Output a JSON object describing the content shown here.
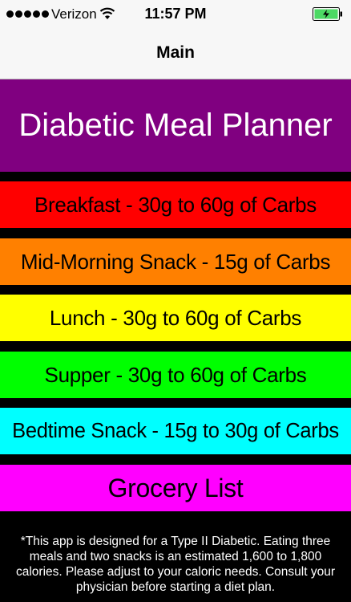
{
  "status_bar": {
    "carrier": "Verizon",
    "time": "11:57 PM",
    "signal_icon": "signal-dots-icon",
    "wifi_icon": "wifi-icon",
    "battery_icon": "battery-charging-icon",
    "battery_color": "#4cd964"
  },
  "nav": {
    "title": "Main"
  },
  "banner": {
    "title": "Diabetic Meal Planner",
    "color": "#800080"
  },
  "menu": {
    "breakfast": {
      "label": "Breakfast - 30g to 60g of Carbs",
      "color": "#ff0000"
    },
    "mid_morning": {
      "label": "Mid-Morning Snack - 15g of Carbs",
      "color": "#ff8000"
    },
    "lunch": {
      "label": "Lunch - 30g to 60g of Carbs",
      "color": "#ffff00"
    },
    "supper": {
      "label": "Supper - 30g to 60g of Carbs",
      "color": "#00ff00"
    },
    "bedtime": {
      "label": "Bedtime Snack - 15g to 30g of Carbs",
      "color": "#00ffff"
    },
    "grocery": {
      "label": "Grocery List",
      "color": "#ff00ff"
    }
  },
  "disclaimer": {
    "text": "*This app is designed for a Type II Diabetic.  Eating three meals and two snacks is an estimated 1,600 to 1,800 calories.  Please adjust to your caloric needs.  Consult your physician before starting a diet plan."
  }
}
